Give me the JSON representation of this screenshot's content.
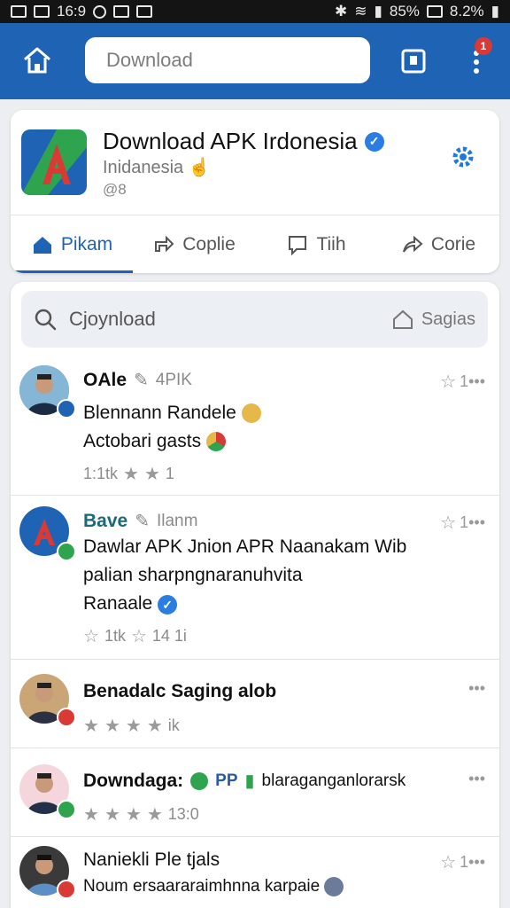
{
  "status_bar": {
    "time": "16:9",
    "battery_pct": "85%",
    "signal_pct": "8.2%"
  },
  "app_bar": {
    "search_placeholder": "Download",
    "notification_count": "1"
  },
  "profile": {
    "title": "Download APK Irdonesia",
    "subtitle": "Inidanesia",
    "meta": "@8",
    "tabs": [
      {
        "label": "Pikam"
      },
      {
        "label": "Coplie"
      },
      {
        "label": "Tiih"
      },
      {
        "label": "Corie"
      }
    ]
  },
  "feed": {
    "search_text": "Cjoynload",
    "search_right_label": "Sagias",
    "posts": [
      {
        "name": "OAle",
        "sub": "4PIK",
        "lines": [
          "Blennann Randele",
          "Actobari gasts"
        ],
        "stats": "1:1tk",
        "stats_end": "1",
        "more": "1•••"
      },
      {
        "name": "Bave",
        "sub": "Ilanm",
        "lines": [
          "Dawlar APK Jnion APR Naanakam Wib",
          "palian sharpngnaranuhvita",
          "Ranaale"
        ],
        "stats": "1tk",
        "stats_end": "14 1i",
        "more": "1•••"
      },
      {
        "name": "Benadalc Saging alob",
        "sub": "",
        "lines": [],
        "stats": "",
        "stats_end": "ik",
        "more": "•••"
      },
      {
        "name": "Downdaga:",
        "sub": "PP",
        "extra": "blaraganganlorarsk",
        "lines": [],
        "stats": "",
        "stats_end": "13:0",
        "more": "•••"
      },
      {
        "name": "Naniekli Ple tjals",
        "sub": "",
        "lines": [
          "Noum ersaararaimhnna karpaie"
        ],
        "stats": "",
        "stats_end": "",
        "more": "1•••"
      }
    ]
  },
  "colors": {
    "brand_blue": "#1f63b5",
    "verified_blue": "#2c7de3",
    "badge_red": "#d93a35",
    "badge_green": "#2ea44f"
  }
}
